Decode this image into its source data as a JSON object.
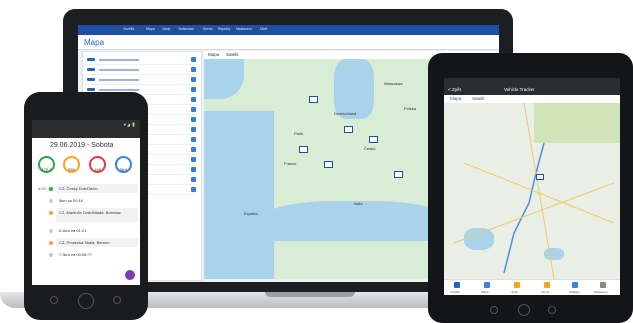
{
  "laptop": {
    "app_title": "Mapa",
    "menu": [
      "Vozidla",
      "Mapa",
      "Jízdy",
      "Tankování",
      "Servis",
      "Reporty",
      "Nastavení",
      "Účet"
    ],
    "map_tabs": [
      "Mapa",
      "Satelit"
    ],
    "places": [
      "Warszawa",
      "Paris",
      "España",
      "Italia",
      "Deutschland",
      "France",
      "Polska",
      "Česko"
    ]
  },
  "phone": {
    "date": "29.06.2019 - Sobota",
    "gauges": [
      {
        "value": "172.2",
        "color": "#2ba84a"
      },
      {
        "value": "556",
        "color": "#f2a623"
      },
      {
        "value": "196",
        "color": "#e23b3b"
      },
      {
        "value": "96.6",
        "color": "#3b7fd6"
      }
    ],
    "timeline": [
      {
        "time": "4:03",
        "text": "CZ, Český Dub/Děčín",
        "dot": "#2ba84a"
      },
      {
        "time": "",
        "text": "5km za 00:16",
        "dot": "#cccccc"
      },
      {
        "time": "",
        "text": "CZ, Martinův Dvůr/Mladá, Boleslav",
        "dot": "#f2a623"
      },
      {
        "time": "",
        "text": "6.4km za 01:21",
        "dot": "#cccccc"
      },
      {
        "time": "",
        "text": "CZ, Prosecká Skála, Beroun",
        "dot": "#f2a623"
      },
      {
        "time": "",
        "text": "7.3km za 00:08:??",
        "dot": "#cccccc"
      }
    ]
  },
  "tablet": {
    "title": "Vehicle Tracker",
    "back": "< Zpět",
    "tabs": [
      "Mapa",
      "Satelit"
    ],
    "bottom": [
      "Vozidla",
      "Mapa",
      "Jízdy",
      "Servis",
      "Náklady",
      "Nastavení"
    ]
  }
}
